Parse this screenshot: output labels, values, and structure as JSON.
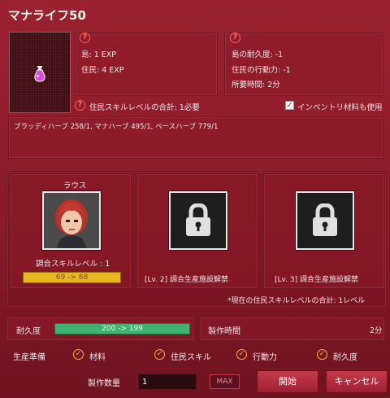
{
  "title": "マナライフ50",
  "rewards": {
    "island_exp": "島: 1 EXP",
    "resident_exp": "住民: 4 EXP"
  },
  "costs": {
    "durability": "島の耐久度: -1",
    "action_power": "住民の行動力: -1",
    "time_required": "所要時間: 2分"
  },
  "requirement": {
    "skill_total": "住民スキルレベルの合計: 1必要",
    "use_inventory_label": "インベントリ材料も使用",
    "use_inventory_checked": true
  },
  "materials_line": "ブラッディハーブ 258/1, マナハーブ 495/1, ベースハーブ 779/1",
  "residents": {
    "name": "ラウス",
    "skill_label": "調合スキルレベル : 1",
    "skill_progress": "69 -> 68",
    "slot2_label": "[Lv. 2] 調合生産施設解禁",
    "slot3_label": "[Lv. 3] 調合生産施設解禁",
    "note": "*現在の住民スキルレベルの合計: 1レベル"
  },
  "durability": {
    "label": "耐久度",
    "value": "200 -> 199"
  },
  "production_time": {
    "label": "製作時間",
    "value": "2分"
  },
  "prep": {
    "label": "生産準備",
    "items": [
      "材料",
      "住民スキル",
      "行動力",
      "耐久度"
    ]
  },
  "quantity": {
    "label": "製作数量",
    "value": "1",
    "max_label": "MAX"
  },
  "buttons": {
    "start": "開始",
    "cancel": "キャンセル"
  },
  "colors": {
    "background": "#8e1b2a",
    "progress_yellow": "#e8b71e",
    "progress_green": "#3fb36f",
    "check_accent": "#f0b83a"
  }
}
